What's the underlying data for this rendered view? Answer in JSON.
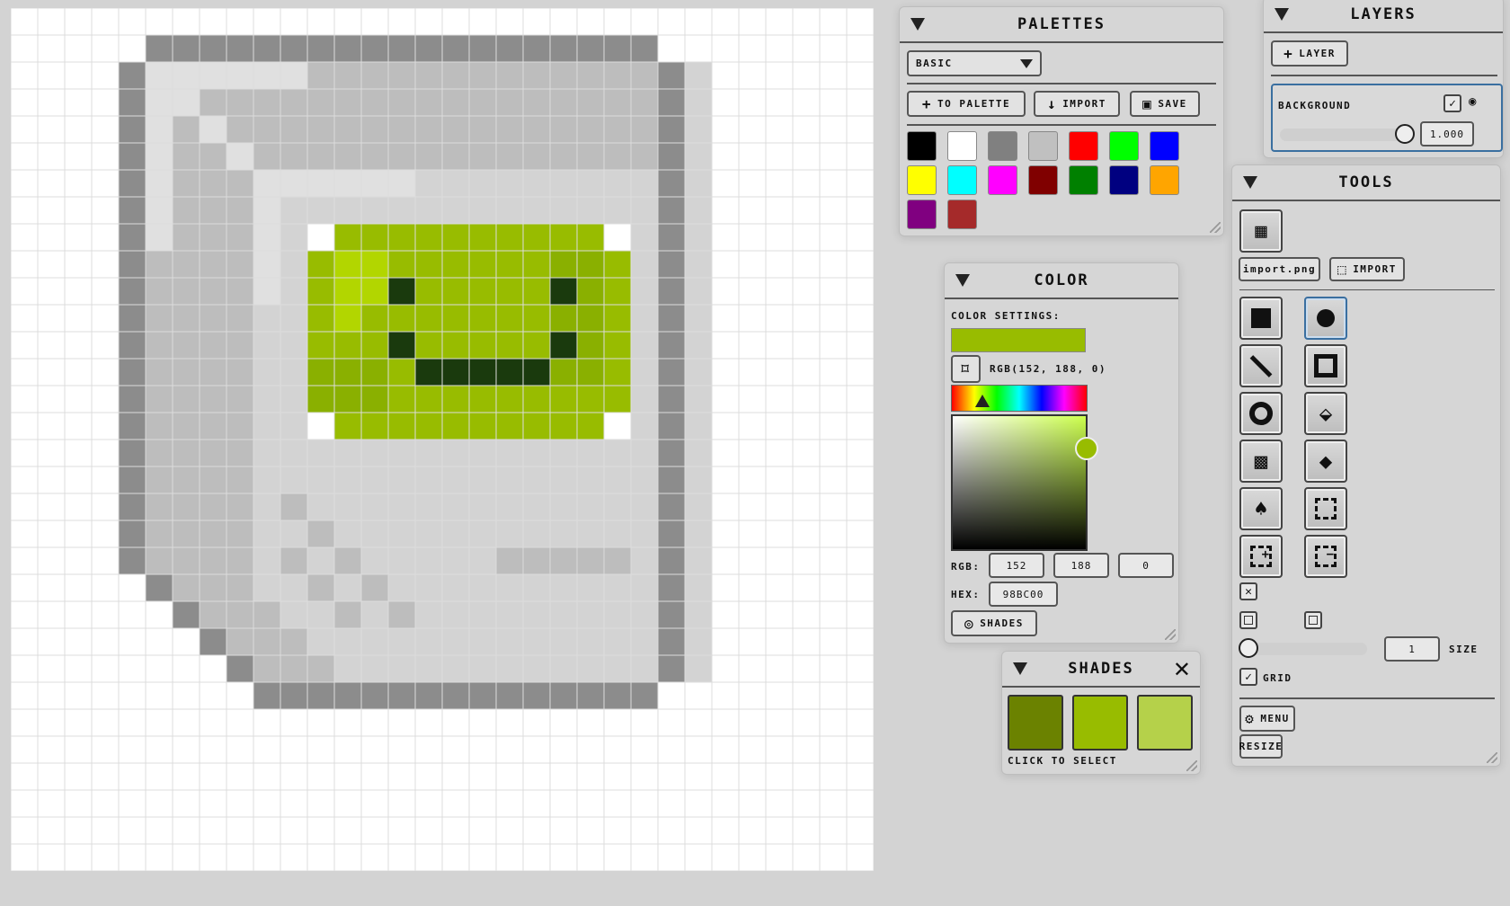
{
  "palettes": {
    "title": "Palettes",
    "selected_palette": "Basic",
    "to_palette_label": "To palette",
    "import_label": "Import",
    "save_label": "Save",
    "swatches": [
      "#000000",
      "#ffffff",
      "#808080",
      "#c0c0c0",
      "#ff0000",
      "#00ff00",
      "#0000ff",
      "#ffff00",
      "#00ffff",
      "#ff00ff",
      "#800000",
      "#008000",
      "#000080",
      "#ffa500",
      "#800080",
      "#a52a2a"
    ]
  },
  "layers": {
    "title": "Layers",
    "add_layer_label": "Layer",
    "items": [
      {
        "name": "Background",
        "visible": true,
        "opacity": "1.000"
      }
    ]
  },
  "color": {
    "title": "Color",
    "settings_label": "Color settings:",
    "current_hex_color": "#98bc00",
    "rgb_text": "RGB(152, 188, 0)",
    "rgb_label": "RGB:",
    "r": "152",
    "g": "188",
    "b": "0",
    "hex_label": "HEX:",
    "hex": "98BC00",
    "shades_label": "Shades"
  },
  "tools": {
    "title": "Tools",
    "import_png_label": "import.png",
    "import_label": "Import",
    "size_value": "1",
    "size_label": "Size",
    "grid_label": "Grid",
    "grid_checked": true,
    "menu_label": "Menu",
    "resize_label": "Resize",
    "active_tool": "circle-brush"
  },
  "shades": {
    "title": "Shades",
    "colors": [
      "#6b8200",
      "#98bc00",
      "#b5d14a"
    ],
    "hint": "Click to select"
  }
}
